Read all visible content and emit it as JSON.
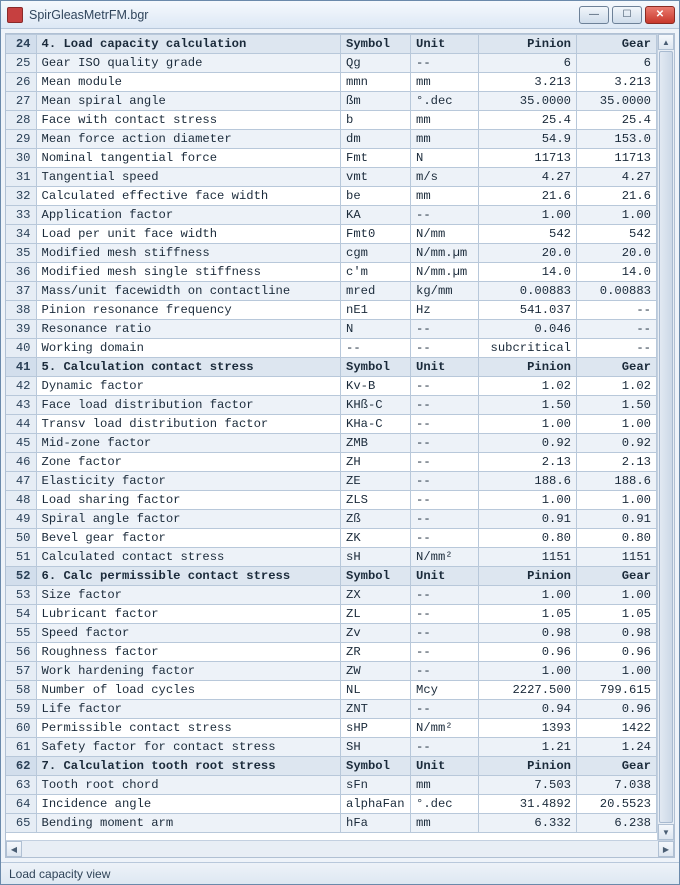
{
  "window": {
    "title": "SpirGleasMetrFM.bgr"
  },
  "statusbar": {
    "text": "Load capacity view"
  },
  "columns": [
    "Symbol",
    "Unit",
    "Pinion",
    "Gear"
  ],
  "rows": [
    {
      "n": 24,
      "head": true,
      "param": "4. Load capacity calculation",
      "sym": "Symbol",
      "unit": "Unit",
      "pin": "Pinion",
      "gear": "Gear"
    },
    {
      "n": 25,
      "param": "Gear ISO quality grade",
      "sym": "Qg",
      "unit": "--",
      "pin": "6",
      "gear": "6"
    },
    {
      "n": 26,
      "param": "Mean module",
      "sym": "mmn",
      "unit": "mm",
      "pin": "3.213",
      "gear": "3.213"
    },
    {
      "n": 27,
      "param": "Mean spiral angle",
      "sym": "ßm",
      "unit": "°.dec",
      "pin": "35.0000",
      "gear": "35.0000"
    },
    {
      "n": 28,
      "param": "Face with contact stress",
      "sym": "b",
      "unit": "mm",
      "pin": "25.4",
      "gear": "25.4"
    },
    {
      "n": 29,
      "param": "Mean force action diameter",
      "sym": "dm",
      "unit": "mm",
      "pin": "54.9",
      "gear": "153.0"
    },
    {
      "n": 30,
      "param": "Nominal tangential force",
      "sym": "Fmt",
      "unit": "N",
      "pin": "11713",
      "gear": "11713"
    },
    {
      "n": 31,
      "param": "Tangential speed",
      "sym": "vmt",
      "unit": "m/s",
      "pin": "4.27",
      "gear": "4.27"
    },
    {
      "n": 32,
      "param": "Calculated effective face width",
      "sym": "be",
      "unit": "mm",
      "pin": "21.6",
      "gear": "21.6"
    },
    {
      "n": 33,
      "param": "Application factor",
      "sym": "KA",
      "unit": "--",
      "pin": "1.00",
      "gear": "1.00"
    },
    {
      "n": 34,
      "param": "Load per unit face width",
      "sym": "Fmt0",
      "unit": "N/mm",
      "pin": "542",
      "gear": "542"
    },
    {
      "n": 35,
      "param": "Modified mesh stiffness",
      "sym": "cgm",
      "unit": "N/mm.µm",
      "pin": "20.0",
      "gear": "20.0"
    },
    {
      "n": 36,
      "param": "Modified mesh single stiffness",
      "sym": "c'm",
      "unit": "N/mm.µm",
      "pin": "14.0",
      "gear": "14.0"
    },
    {
      "n": 37,
      "param": "Mass/unit facewidth on contactline",
      "sym": "mred",
      "unit": "kg/mm",
      "pin": "0.00883",
      "gear": "0.00883"
    },
    {
      "n": 38,
      "param": "Pinion resonance frequency",
      "sym": "nE1",
      "unit": "Hz",
      "pin": "541.037",
      "gear": "--"
    },
    {
      "n": 39,
      "param": "Resonance ratio",
      "sym": "N",
      "unit": "--",
      "pin": "0.046",
      "gear": "--"
    },
    {
      "n": 40,
      "param": "Working domain",
      "sym": "--",
      "unit": "--",
      "pin": "subcritical",
      "gear": "--"
    },
    {
      "n": 41,
      "head": true,
      "param": "5. Calculation contact stress",
      "sym": "Symbol",
      "unit": "Unit",
      "pin": "Pinion",
      "gear": "Gear"
    },
    {
      "n": 42,
      "param": "Dynamic factor",
      "sym": "Kv-B",
      "unit": "--",
      "pin": "1.02",
      "gear": "1.02"
    },
    {
      "n": 43,
      "param": "Face load distribution factor",
      "sym": "KHß-C",
      "unit": "--",
      "pin": "1.50",
      "gear": "1.50"
    },
    {
      "n": 44,
      "param": "Transv load distribution factor",
      "sym": "KHa-C",
      "unit": "--",
      "pin": "1.00",
      "gear": "1.00"
    },
    {
      "n": 45,
      "param": "Mid-zone factor",
      "sym": "ZMB",
      "unit": "--",
      "pin": "0.92",
      "gear": "0.92"
    },
    {
      "n": 46,
      "param": "Zone factor",
      "sym": "ZH",
      "unit": "--",
      "pin": "2.13",
      "gear": "2.13"
    },
    {
      "n": 47,
      "param": "Elasticity factor",
      "sym": "ZE",
      "unit": "--",
      "pin": "188.6",
      "gear": "188.6"
    },
    {
      "n": 48,
      "param": "Load sharing factor",
      "sym": "ZLS",
      "unit": "--",
      "pin": "1.00",
      "gear": "1.00"
    },
    {
      "n": 49,
      "param": "Spiral angle factor",
      "sym": "Zß",
      "unit": "--",
      "pin": "0.91",
      "gear": "0.91"
    },
    {
      "n": 50,
      "param": "Bevel gear factor",
      "sym": "ZK",
      "unit": "--",
      "pin": "0.80",
      "gear": "0.80"
    },
    {
      "n": 51,
      "param": "Calculated contact stress",
      "sym": "sH",
      "unit": "N/mm²",
      "pin": "1151",
      "gear": "1151"
    },
    {
      "n": 52,
      "head": true,
      "param": "6. Calc permissible contact stress",
      "sym": "Symbol",
      "unit": "Unit",
      "pin": "Pinion",
      "gear": "Gear"
    },
    {
      "n": 53,
      "param": "Size factor",
      "sym": "ZX",
      "unit": "--",
      "pin": "1.00",
      "gear": "1.00"
    },
    {
      "n": 54,
      "param": "Lubricant factor",
      "sym": "ZL",
      "unit": "--",
      "pin": "1.05",
      "gear": "1.05"
    },
    {
      "n": 55,
      "param": "Speed factor",
      "sym": "Zv",
      "unit": "--",
      "pin": "0.98",
      "gear": "0.98"
    },
    {
      "n": 56,
      "param": "Roughness factor",
      "sym": "ZR",
      "unit": "--",
      "pin": "0.96",
      "gear": "0.96"
    },
    {
      "n": 57,
      "param": "Work hardening factor",
      "sym": "ZW",
      "unit": "--",
      "pin": "1.00",
      "gear": "1.00"
    },
    {
      "n": 58,
      "param": "Number of load cycles",
      "sym": "NL",
      "unit": "Mcy",
      "pin": "2227.500",
      "gear": "799.615"
    },
    {
      "n": 59,
      "param": "Life factor",
      "sym": "ZNT",
      "unit": "--",
      "pin": "0.94",
      "gear": "0.96"
    },
    {
      "n": 60,
      "param": "Permissible contact stress",
      "sym": "sHP",
      "unit": "N/mm²",
      "pin": "1393",
      "gear": "1422"
    },
    {
      "n": 61,
      "param": "Safety factor for contact stress",
      "sym": "SH",
      "unit": "--",
      "pin": "1.21",
      "gear": "1.24"
    },
    {
      "n": 62,
      "head": true,
      "param": "7. Calculation tooth root stress",
      "sym": "Symbol",
      "unit": "Unit",
      "pin": "Pinion",
      "gear": "Gear"
    },
    {
      "n": 63,
      "param": "Tooth root chord",
      "sym": "sFn",
      "unit": "mm",
      "pin": "7.503",
      "gear": "7.038"
    },
    {
      "n": 64,
      "param": "Incidence angle",
      "sym": "alphaFan",
      "unit": "°.dec",
      "pin": "31.4892",
      "gear": "20.5523"
    },
    {
      "n": 65,
      "param": "Bending moment arm",
      "sym": "hFa",
      "unit": "mm",
      "pin": "6.332",
      "gear": "6.238"
    }
  ]
}
